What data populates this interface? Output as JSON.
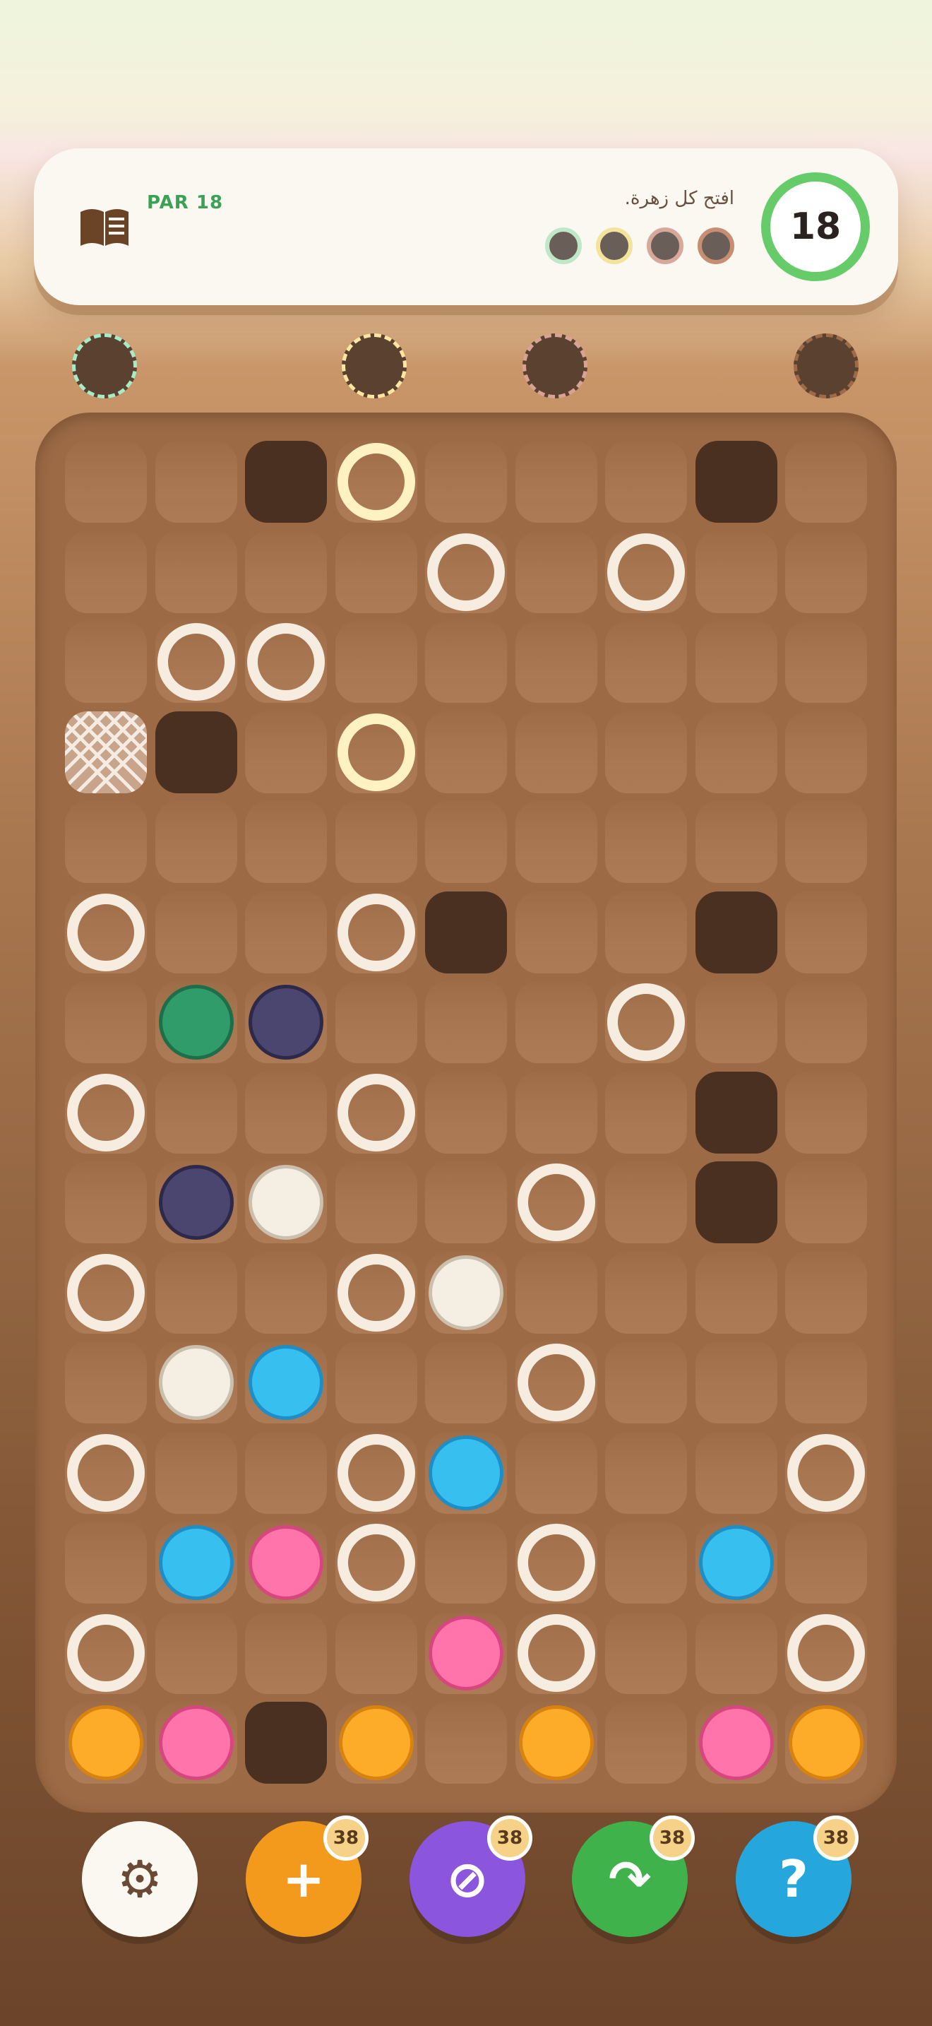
{
  "header": {
    "par_label": "PAR 18",
    "instruction": "افتح كل زهرة.",
    "moves": "18",
    "goals": [
      {
        "name": "goal-gray-1",
        "border": "#c88e72",
        "fill": "#6a5e58"
      },
      {
        "name": "goal-gray-2",
        "border": "#d8a99a",
        "fill": "#6a5e58"
      },
      {
        "name": "goal-yellow",
        "border": "#f4e39a",
        "fill": "#6a5e58"
      },
      {
        "name": "goal-green",
        "border": "#bfe8c9",
        "fill": "#6a5e58"
      }
    ],
    "book_icon": "book-icon"
  },
  "bins": [
    {
      "name": "bin-mint",
      "border": "#a6ecc6"
    },
    {
      "name": "bin-yellow",
      "border": "#fde7a0"
    },
    {
      "name": "bin-rose",
      "border": "#d8a394"
    },
    {
      "name": "bin-brown",
      "border": "#9e6a48"
    }
  ],
  "palette": {
    "G": {
      "fill": "#2f9c6a",
      "border": "#1f6e4a",
      "name": "green-flower"
    },
    "N": {
      "fill": "#4b4670",
      "border": "#2e2948",
      "name": "navy-flower"
    },
    "W": {
      "fill": "#f4efe2",
      "border": "#cbbfae",
      "name": "white-flower"
    },
    "B": {
      "fill": "#37c0ef",
      "border": "#1d8fc6",
      "name": "blue-flower"
    },
    "P": {
      "fill": "#ff74ab",
      "border": "#d7477f",
      "name": "pink-flower"
    },
    "O": {
      "fill": "#fcac28",
      "border": "#d8830f",
      "name": "orange-flower"
    }
  },
  "grid": [
    [
      ".",
      ".",
      "E",
      "Y",
      ".",
      ".",
      ".",
      "E",
      "."
    ],
    [
      ".",
      ".",
      ".",
      ".",
      "R",
      ".",
      "R",
      ".",
      "."
    ],
    [
      ".",
      "R",
      "R",
      ".",
      ".",
      ".",
      ".",
      ".",
      "."
    ],
    [
      "X",
      "E",
      ".",
      "Y",
      ".",
      ".",
      ".",
      ".",
      "."
    ],
    [
      ".",
      ".",
      ".",
      ".",
      ".",
      ".",
      ".",
      ".",
      "."
    ],
    [
      "R",
      ".",
      ".",
      "R",
      "E",
      ".",
      ".",
      "E",
      "."
    ],
    [
      ".",
      "G",
      "N",
      ".",
      ".",
      ".",
      "R",
      ".",
      "."
    ],
    [
      "R",
      ".",
      ".",
      "R",
      ".",
      ".",
      ".",
      "E",
      "."
    ],
    [
      ".",
      "N",
      "W",
      ".",
      ".",
      "R",
      ".",
      "E",
      "."
    ],
    [
      "R",
      ".",
      ".",
      "R",
      "W",
      ".",
      ".",
      ".",
      "."
    ],
    [
      ".",
      "W",
      "B",
      ".",
      ".",
      "R",
      ".",
      ".",
      "."
    ],
    [
      "R",
      ".",
      ".",
      "R",
      "B",
      ".",
      ".",
      ".",
      "R"
    ],
    [
      ".",
      "B",
      "P",
      "R",
      ".",
      "R",
      ".",
      "B",
      "."
    ],
    [
      "R",
      ".",
      ".",
      ".",
      "P",
      "R",
      ".",
      ".",
      "R"
    ],
    [
      "O",
      "P",
      "E",
      "O",
      ".",
      "O",
      ".",
      "P",
      "O"
    ]
  ],
  "controls": [
    {
      "name": "settings-button",
      "icon": "gear-icon",
      "symbol": "⚙",
      "bg": "#fbf8f2",
      "color": "#6a4a34",
      "badge": ""
    },
    {
      "name": "add-button",
      "icon": "plus-icon",
      "symbol": "+",
      "bg": "#f39a1c",
      "color": "#ffffff",
      "badge": "38"
    },
    {
      "name": "block-button",
      "icon": "prohibit-icon",
      "symbol": "⊘",
      "bg": "#8b55dd",
      "color": "#ffffff",
      "badge": "38"
    },
    {
      "name": "skip-button",
      "icon": "redo-arrow-icon",
      "symbol": "↷",
      "bg": "#3fb24c",
      "color": "#ffffff",
      "badge": "38"
    },
    {
      "name": "hint-button",
      "icon": "question-icon",
      "symbol": "?",
      "bg": "#25a6dd",
      "color": "#ffffff",
      "badge": "38"
    }
  ]
}
